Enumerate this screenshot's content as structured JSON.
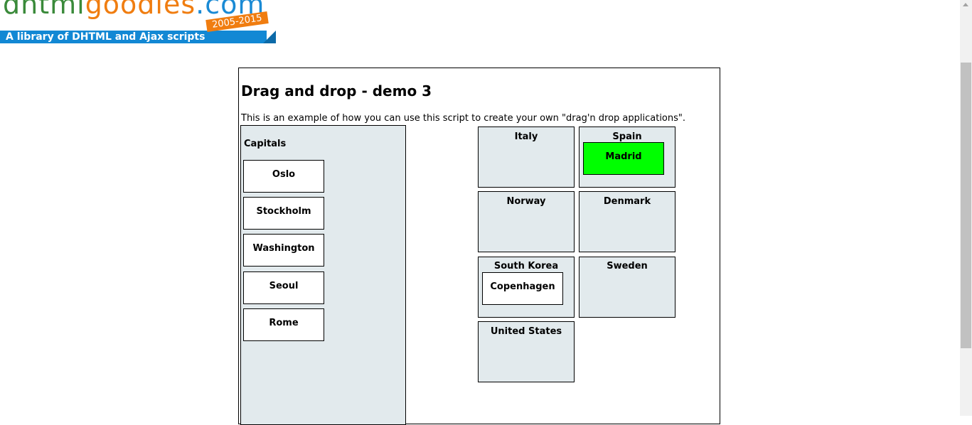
{
  "logo": {
    "part1": "dhtml",
    "part2": "goodies",
    "part3": ".com",
    "tagline": "A library of DHTML and Ajax scripts",
    "years": "2005-2015"
  },
  "title": "Drag and drop - demo 3",
  "intro": "This is an example of how you can use this script to create your own \"drag'n drop applications\".",
  "capitals": {
    "label": "Capitals",
    "items": [
      "Oslo",
      "Stockholm",
      "Washington",
      "Seoul",
      "Rome"
    ]
  },
  "countries": [
    {
      "name": "Italy"
    },
    {
      "name": "Spain",
      "dropped": "Madrid",
      "dropped_color": "#00ff00"
    },
    {
      "name": "Norway"
    },
    {
      "name": "Denmark"
    },
    {
      "name": "South Korea",
      "dropped": "Copenhagen"
    },
    {
      "name": "Sweden"
    },
    {
      "name": "United States"
    }
  ]
}
